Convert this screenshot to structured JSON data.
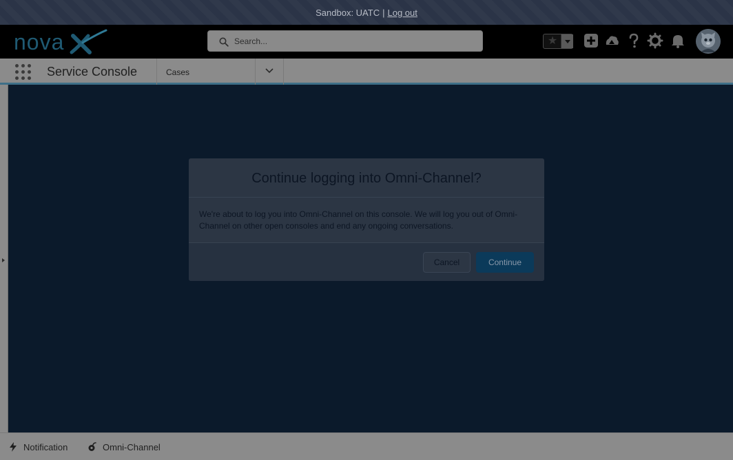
{
  "sandbox": {
    "label": "Sandbox: UATC",
    "separator": "|",
    "logout": "Log out"
  },
  "header": {
    "logo": "novaX",
    "search": {
      "placeholder": "Search...",
      "value": ""
    },
    "icons": [
      "favorites-star-icon",
      "favorites-list-icon",
      "global-actions-plus-icon",
      "trailhead-icon",
      "help-icon",
      "setup-gear-icon",
      "notifications-bell-icon",
      "user-avatar"
    ]
  },
  "nav": {
    "app_name": "Service Console",
    "tab_label": "Cases"
  },
  "modal": {
    "title": "Continue logging into Omni-Channel?",
    "body": "We're about to log you into Omni-Channel on this console. We will log you out of Omni-Channel on other open consoles and end any ongoing conversations.",
    "cancel_label": "Cancel",
    "continue_label": "Continue"
  },
  "utility_bar": {
    "items": [
      {
        "label": "Notification",
        "icon": "lightning-bolt-icon"
      },
      {
        "label": "Omni-Channel",
        "icon": "omni-channel-icon"
      }
    ]
  },
  "colors": {
    "overlay": "#0b1a2b",
    "brand_primary": "#0b3a5a",
    "nav_border": "#3e6f88"
  }
}
